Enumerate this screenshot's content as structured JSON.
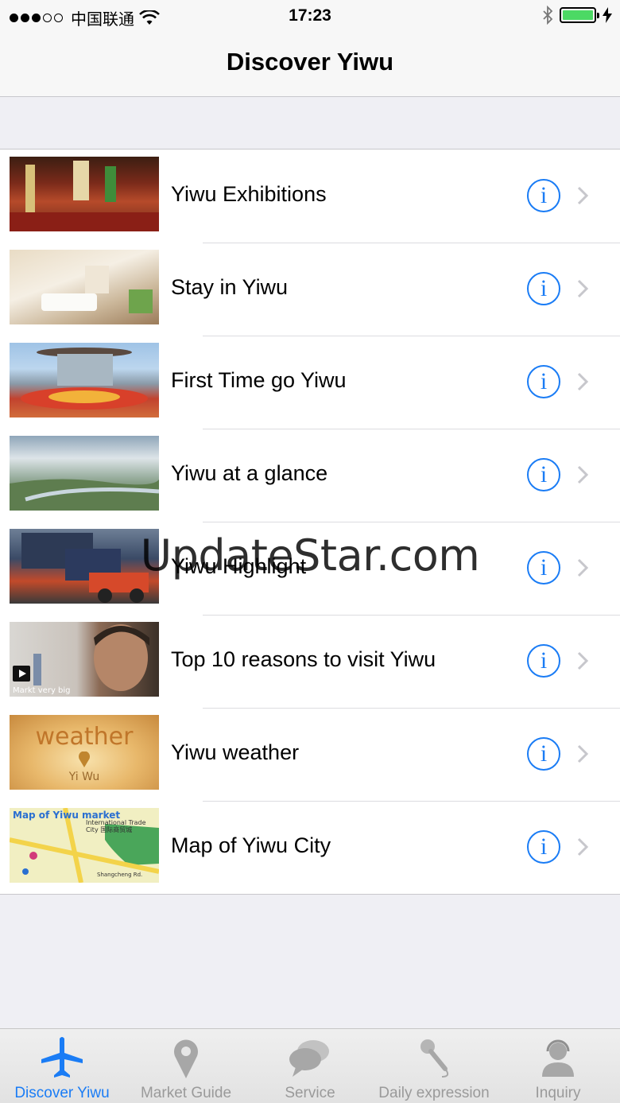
{
  "status_bar": {
    "carrier": "中国联通",
    "time": "17:23",
    "signal_strength_of_5": 3,
    "battery_level_fraction": 1.0
  },
  "nav": {
    "title": "Discover Yiwu"
  },
  "list": {
    "items": [
      {
        "title": "Yiwu Exhibitions"
      },
      {
        "title": "Stay in Yiwu"
      },
      {
        "title": "First Time go Yiwu"
      },
      {
        "title": "Yiwu at a glance"
      },
      {
        "title": "Yiwu Highlight"
      },
      {
        "title": "Top 10 reasons to visit Yiwu",
        "thumb_caption": "Markt very big"
      },
      {
        "title": "Yiwu weather",
        "thumb_word": "weather",
        "thumb_sub": "Yi Wu"
      },
      {
        "title": "Map of Yiwu City",
        "thumb_title": "Map of Yiwu market",
        "thumb_sub": "International Trade City 国际商贸城",
        "thumb_road": "Shangcheng Rd."
      }
    ],
    "info_glyph": "i"
  },
  "watermark": "UpdateStar.com",
  "tab_bar": {
    "tabs": [
      {
        "label": "Discover Yiwu",
        "icon": "airplane-icon",
        "active": true
      },
      {
        "label": "Market Guide",
        "icon": "map-pin-icon",
        "active": false
      },
      {
        "label": "Service",
        "icon": "chat-bubbles-icon",
        "active": false
      },
      {
        "label": "Daily expression",
        "icon": "microphone-icon",
        "active": false
      },
      {
        "label": "Inquiry",
        "icon": "customer-service-icon",
        "active": false
      }
    ]
  },
  "colors": {
    "accent": "#1a7cf5",
    "tab_inactive": "#9a9a9a",
    "background": "#efeff4",
    "battery": "#4cd964"
  }
}
